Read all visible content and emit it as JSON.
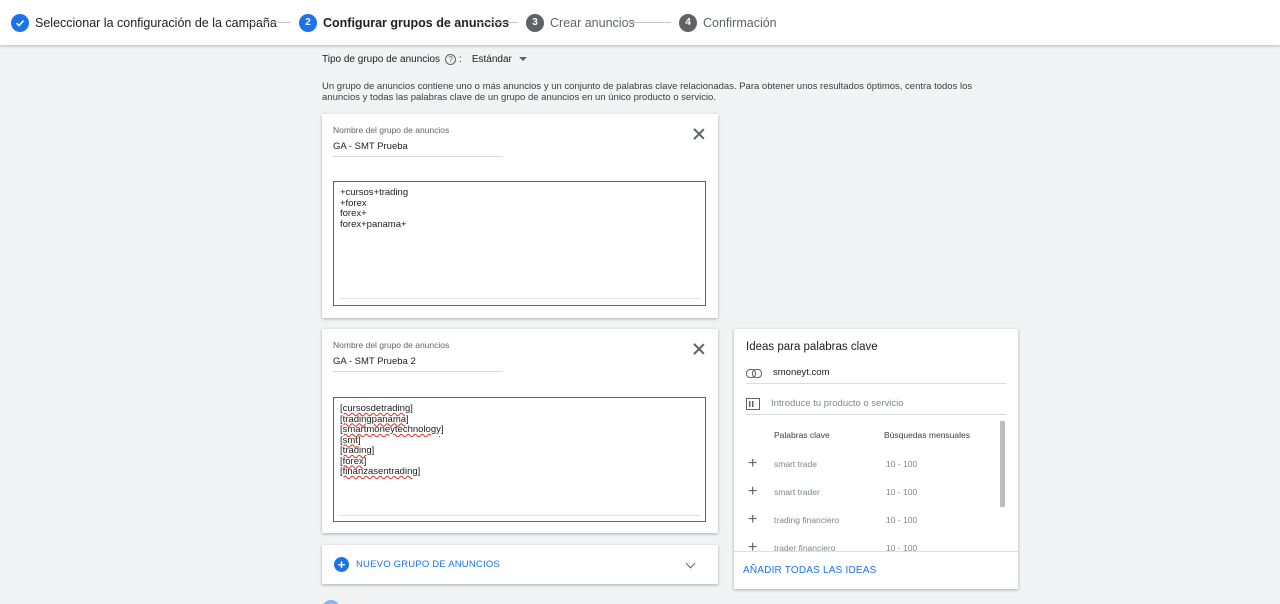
{
  "stepper": {
    "steps": [
      {
        "num": "",
        "label": "Seleccionar la configuración de la campaña",
        "state": "done"
      },
      {
        "num": "2",
        "label": "Configurar grupos de anuncios",
        "state": "active"
      },
      {
        "num": "3",
        "label": "Crear anuncios",
        "state": "pending"
      },
      {
        "num": "4",
        "label": "Confirmación",
        "state": "pending"
      }
    ]
  },
  "ad_group_type": {
    "label": "Tipo de grupo de anuncios",
    "help_glyph": "?",
    "colon": ":",
    "value": "Estándar"
  },
  "description": "Un grupo de anuncios contiene uno o más anuncios y un conjunto de palabras clave relacionadas. Para obtener unos resultados óptimos, centra todos los anuncios y todas las palabras clave de un grupo de anuncios en un único producto o servicio.",
  "ad_groups": [
    {
      "name_label": "Nombre del grupo de anuncios",
      "name_value": "GA - SMT Prueba",
      "keywords": [
        "+cursos+trading",
        "+forex",
        "forex+",
        "forex+panama+"
      ]
    },
    {
      "name_label": "Nombre del grupo de anuncios",
      "name_value": "GA - SMT Prueba 2",
      "keywords": [
        "[cursosdetrading]",
        "[tradingpanama]",
        "[smartmoneytechnology]",
        "[smt]",
        "[trading]",
        "[forex]",
        "[finanzasentrading]"
      ]
    }
  ],
  "new_ad_group": {
    "label": "NUEVO GRUPO DE ANUNCIOS",
    "icon": "+"
  },
  "keyword_ideas": {
    "title": "Ideas para palabras clave",
    "url_value": "smoneyt.com",
    "product_placeholder": "Introduce tu producto o servicio",
    "col_keywords": "Palabras clave",
    "col_searches": "Búsquedas mensuales",
    "ideas": [
      {
        "keyword": "smart trade",
        "searches": "10 - 100"
      },
      {
        "keyword": "smart trader",
        "searches": "10 - 100"
      },
      {
        "keyword": "trading financiero",
        "searches": "10 - 100"
      },
      {
        "keyword": "trader financiero",
        "searches": "10 - 100"
      }
    ],
    "add_all_label": "AÑADIR TODAS LAS IDEAS"
  },
  "colors": {
    "accent": "#1a73e8",
    "error": "#d93025",
    "background": "#f1f3f4"
  }
}
